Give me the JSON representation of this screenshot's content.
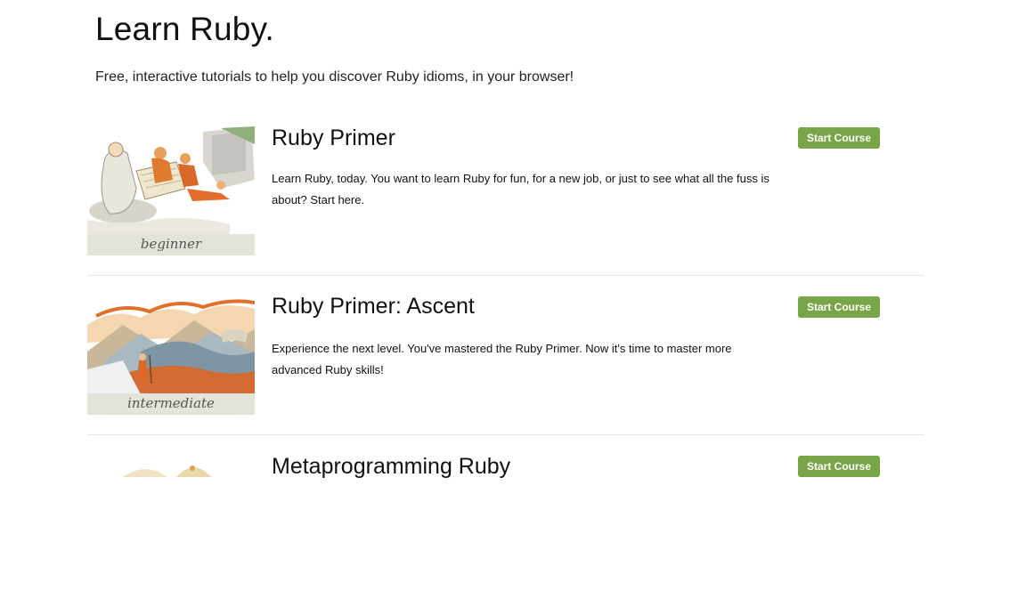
{
  "header": {
    "title": "Learn Ruby.",
    "subtitle": "Free, interactive tutorials to help you discover Ruby idioms, in your browser!"
  },
  "courses": [
    {
      "title": "Ruby Primer",
      "description": "Learn Ruby, today. You want to learn Ruby for fun, for a new job, or just to see what all the fuss is about? Start here.",
      "level": "beginner",
      "button_label": "Start Course",
      "illustration": "monk-reading-scroll-illustration"
    },
    {
      "title": "Ruby Primer: Ascent",
      "description": "Experience the next level. You've mastered the Ruby Primer. Now it's time to master more advanced Ruby skills!",
      "level": "intermediate",
      "button_label": "Start Course",
      "illustration": "mountain-climbing-monk-illustration"
    },
    {
      "title": "Metaprogramming Ruby",
      "button_label": "Start Course",
      "illustration": "course-illustration"
    }
  ],
  "colors": {
    "button": "#78a547",
    "badge_bg": "#e4e3d9",
    "divider": "#e6e6e6"
  }
}
